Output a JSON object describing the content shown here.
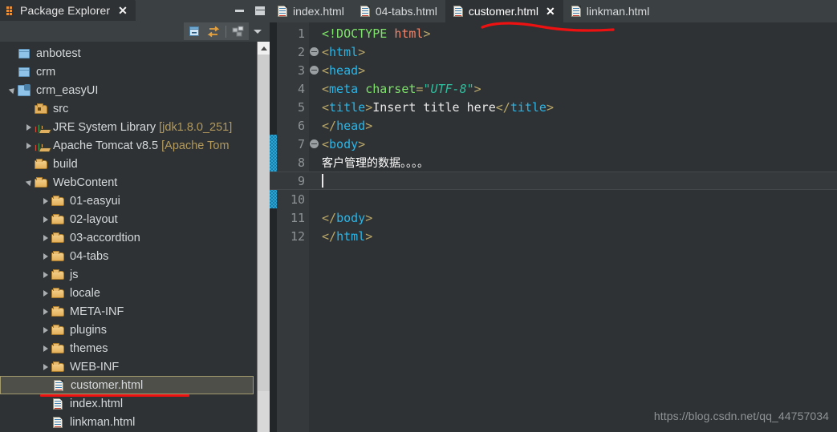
{
  "explorer": {
    "title": "Package Explorer",
    "tab_icon": "package-explorer-icon",
    "close_label": "✕",
    "window_controls": {
      "minimize": "minimize",
      "maximize": "maximize"
    },
    "toolbar": [
      {
        "name": "collapse-all-icon",
        "label": "Collapse All"
      },
      {
        "name": "link-with-editor-icon",
        "label": "Link with Editor"
      },
      {
        "name": "view-menu-icon",
        "label": "View Menu"
      },
      {
        "name": "chevron-down-icon",
        "label": "Menu"
      }
    ],
    "tree": [
      {
        "label": "anbotest",
        "icon": "project-closed-icon",
        "indent": 0,
        "arrow": "none",
        "selected": false
      },
      {
        "label": "crm",
        "icon": "project-closed-icon",
        "indent": 0,
        "arrow": "none",
        "selected": false
      },
      {
        "label": "crm_easyUI",
        "icon": "java-project-icon",
        "indent": 0,
        "arrow": "open",
        "selected": false
      },
      {
        "label": "src",
        "icon": "source-folder-icon",
        "indent": 1,
        "arrow": "none",
        "selected": false
      },
      {
        "label": "JRE System Library ",
        "suffix": "[jdk1.8.0_251]",
        "icon": "library-icon",
        "indent": 1,
        "arrow": "closed",
        "selected": false
      },
      {
        "label": "Apache Tomcat v8.5 ",
        "suffix": "[Apache Tom",
        "icon": "library-icon",
        "indent": 1,
        "arrow": "closed",
        "selected": false
      },
      {
        "label": "build",
        "icon": "folder-icon",
        "indent": 1,
        "arrow": "none",
        "selected": false
      },
      {
        "label": "WebContent",
        "icon": "folder-icon",
        "indent": 1,
        "arrow": "open",
        "selected": false
      },
      {
        "label": "01-easyui",
        "icon": "folder-icon",
        "indent": 2,
        "arrow": "closed",
        "selected": false
      },
      {
        "label": "02-layout",
        "icon": "folder-icon",
        "indent": 2,
        "arrow": "closed",
        "selected": false
      },
      {
        "label": "03-accordtion",
        "icon": "folder-icon",
        "indent": 2,
        "arrow": "closed",
        "selected": false
      },
      {
        "label": "04-tabs",
        "icon": "folder-icon",
        "indent": 2,
        "arrow": "closed",
        "selected": false
      },
      {
        "label": "js",
        "icon": "folder-icon",
        "indent": 2,
        "arrow": "closed",
        "selected": false
      },
      {
        "label": "locale",
        "icon": "folder-icon",
        "indent": 2,
        "arrow": "closed",
        "selected": false
      },
      {
        "label": "META-INF",
        "icon": "folder-icon",
        "indent": 2,
        "arrow": "closed",
        "selected": false
      },
      {
        "label": "plugins",
        "icon": "folder-icon",
        "indent": 2,
        "arrow": "closed",
        "selected": false
      },
      {
        "label": "themes",
        "icon": "folder-icon",
        "indent": 2,
        "arrow": "closed",
        "selected": false
      },
      {
        "label": "WEB-INF",
        "icon": "folder-icon",
        "indent": 2,
        "arrow": "closed",
        "selected": false
      },
      {
        "label": "customer.html",
        "icon": "html-file-icon",
        "indent": 2,
        "arrow": "none",
        "selected": true
      },
      {
        "label": "index.html",
        "icon": "html-file-icon",
        "indent": 2,
        "arrow": "none",
        "selected": false
      },
      {
        "label": "linkman.html",
        "icon": "html-file-icon",
        "indent": 2,
        "arrow": "none",
        "selected": false
      }
    ]
  },
  "editor": {
    "tabs": [
      {
        "label": "index.html",
        "icon": "html-file-icon",
        "active": false,
        "closable": false
      },
      {
        "label": "04-tabs.html",
        "icon": "html-file-icon",
        "active": false,
        "closable": false
      },
      {
        "label": "customer.html",
        "icon": "html-file-icon",
        "active": true,
        "closable": true,
        "close_label": "✕"
      },
      {
        "label": "linkman.html",
        "icon": "html-file-icon",
        "active": false,
        "closable": false
      }
    ],
    "line_numbers": [
      "1",
      "2",
      "3",
      "4",
      "5",
      "6",
      "7",
      "8",
      "9",
      "10",
      "11",
      "12"
    ],
    "fold_markers": {
      "2": "collapse",
      "3": "collapse",
      "7": "collapse"
    },
    "current_line": 9,
    "change_bar_lines": [
      7,
      8,
      9,
      10
    ],
    "code_lines": [
      {
        "n": "1",
        "tokens": [
          {
            "t": "<!DOCTYPE",
            "c": "doctype"
          },
          {
            "t": " ",
            "c": "plain"
          },
          {
            "t": "html",
            "c": "doctype-name"
          },
          {
            "t": ">",
            "c": "punct"
          }
        ]
      },
      {
        "n": "2",
        "tokens": [
          {
            "t": "<",
            "c": "punct"
          },
          {
            "t": "html",
            "c": "tag"
          },
          {
            "t": ">",
            "c": "punct"
          }
        ]
      },
      {
        "n": "3",
        "tokens": [
          {
            "t": "<",
            "c": "punct"
          },
          {
            "t": "head",
            "c": "tag"
          },
          {
            "t": ">",
            "c": "punct"
          }
        ]
      },
      {
        "n": "4",
        "tokens": [
          {
            "t": "<",
            "c": "punct"
          },
          {
            "t": "meta",
            "c": "tag"
          },
          {
            "t": " ",
            "c": "plain"
          },
          {
            "t": "charset",
            "c": "attr"
          },
          {
            "t": "=",
            "c": "punct"
          },
          {
            "t": "\"UTF-8\"",
            "c": "value"
          },
          {
            "t": ">",
            "c": "punct"
          }
        ]
      },
      {
        "n": "5",
        "tokens": [
          {
            "t": "<",
            "c": "punct"
          },
          {
            "t": "title",
            "c": "tag"
          },
          {
            "t": ">",
            "c": "punct"
          },
          {
            "t": "Insert title here",
            "c": "text"
          },
          {
            "t": "</",
            "c": "punct"
          },
          {
            "t": "title",
            "c": "tag"
          },
          {
            "t": ">",
            "c": "punct"
          }
        ]
      },
      {
        "n": "6",
        "tokens": [
          {
            "t": "</",
            "c": "punct"
          },
          {
            "t": "head",
            "c": "tag"
          },
          {
            "t": ">",
            "c": "punct"
          }
        ]
      },
      {
        "n": "7",
        "tokens": [
          {
            "t": "<",
            "c": "punct"
          },
          {
            "t": "body",
            "c": "tag"
          },
          {
            "t": ">",
            "c": "punct"
          }
        ]
      },
      {
        "n": "8",
        "tokens": [
          {
            "t": "客户管理的数据。。。。",
            "c": "cjk-text"
          }
        ]
      },
      {
        "n": "9",
        "tokens": []
      },
      {
        "n": "10",
        "tokens": []
      },
      {
        "n": "11",
        "tokens": [
          {
            "t": "</",
            "c": "punct"
          },
          {
            "t": "body",
            "c": "tag"
          },
          {
            "t": ">",
            "c": "punct"
          }
        ]
      },
      {
        "n": "12",
        "tokens": [
          {
            "t": "</",
            "c": "punct"
          },
          {
            "t": "html",
            "c": "tag"
          },
          {
            "t": ">",
            "c": "punct"
          }
        ]
      }
    ]
  },
  "watermark": "https://blog.csdn.net/qq_44757034",
  "annotations": [
    {
      "name": "red-underline-editor-tab",
      "shape": "wavy-line",
      "color": "#ee1111"
    },
    {
      "name": "red-underline-tree-item",
      "shape": "straight-line",
      "color": "#ee1111"
    }
  ],
  "colors": {
    "panel_bg": "#3b4043",
    "content_bg": "#2f3234",
    "gutter_bg": "#36393b",
    "text": "#d6d9db",
    "tag": "#29b6e8",
    "punct": "#b9a86a",
    "attr": "#7de36a",
    "value": "#2fbf9f",
    "doctype": "#7de36a",
    "doctype_name": "#f0846a",
    "annotation_red": "#ee1111",
    "selection_border": "#a39a6d"
  }
}
